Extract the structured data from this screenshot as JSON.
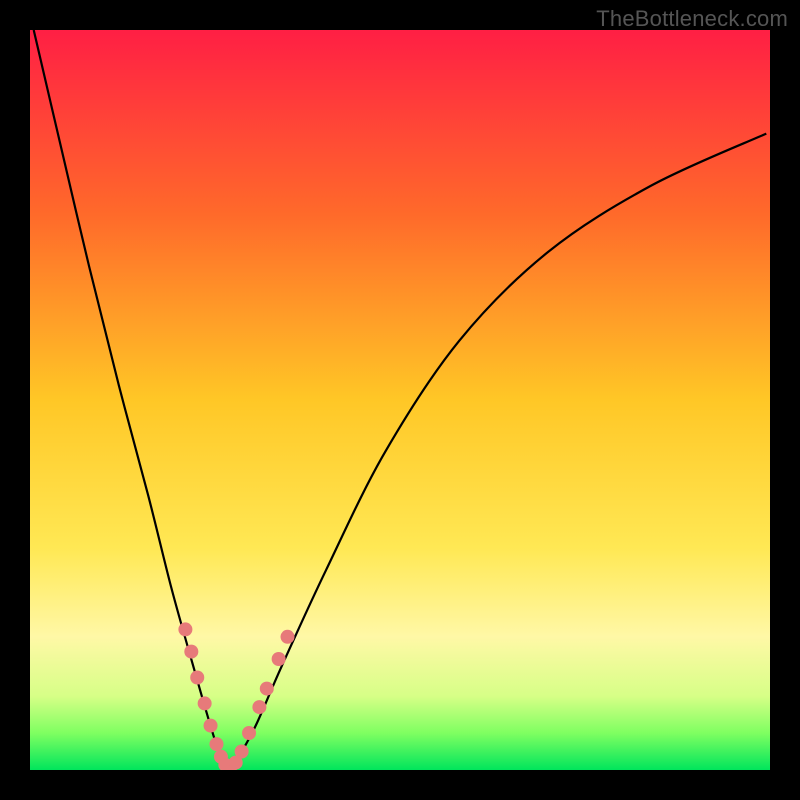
{
  "watermark": {
    "text": "TheBottleneck.com"
  },
  "chart_data": {
    "type": "line",
    "title": "",
    "xlabel": "",
    "ylabel": "",
    "xlim": [
      0,
      100
    ],
    "ylim": [
      0,
      100
    ],
    "grid": false,
    "legend": false,
    "background_gradient_stops": [
      {
        "offset": 0,
        "color": "#ff1f44"
      },
      {
        "offset": 0.25,
        "color": "#ff6a2a"
      },
      {
        "offset": 0.5,
        "color": "#ffc726"
      },
      {
        "offset": 0.7,
        "color": "#ffe854"
      },
      {
        "offset": 0.82,
        "color": "#fff8a6"
      },
      {
        "offset": 0.9,
        "color": "#d7ff87"
      },
      {
        "offset": 0.95,
        "color": "#7fff61"
      },
      {
        "offset": 1.0,
        "color": "#00e55c"
      }
    ],
    "series": [
      {
        "name": "bottleneck-curve",
        "stroke": "#000000",
        "stroke_width": 2.2,
        "x": [
          0.5,
          4,
          8,
          12,
          16,
          19,
          21.5,
          23.5,
          25.0,
          26.0,
          26.8,
          28.0,
          30.5,
          34,
          40,
          48,
          58,
          70,
          84,
          99.5
        ],
        "y": [
          100,
          85,
          68,
          52,
          37,
          25,
          16,
          9,
          4,
          1.3,
          0.2,
          1.5,
          6,
          14,
          27,
          43,
          58,
          70,
          79,
          86
        ]
      }
    ],
    "markers": {
      "name": "highlight-dots",
      "fill": "#e77a7a",
      "radius": 7,
      "points": [
        {
          "x": 21.0,
          "y": 19.0
        },
        {
          "x": 21.8,
          "y": 16.0
        },
        {
          "x": 22.6,
          "y": 12.5
        },
        {
          "x": 23.6,
          "y": 9.0
        },
        {
          "x": 24.4,
          "y": 6.0
        },
        {
          "x": 25.2,
          "y": 3.5
        },
        {
          "x": 25.8,
          "y": 1.8
        },
        {
          "x": 26.4,
          "y": 0.7
        },
        {
          "x": 27.0,
          "y": 0.2
        },
        {
          "x": 27.8,
          "y": 1.0
        },
        {
          "x": 28.6,
          "y": 2.5
        },
        {
          "x": 29.6,
          "y": 5.0
        },
        {
          "x": 31.0,
          "y": 8.5
        },
        {
          "x": 32.0,
          "y": 11.0
        },
        {
          "x": 33.6,
          "y": 15.0
        },
        {
          "x": 34.8,
          "y": 18.0
        }
      ]
    }
  }
}
